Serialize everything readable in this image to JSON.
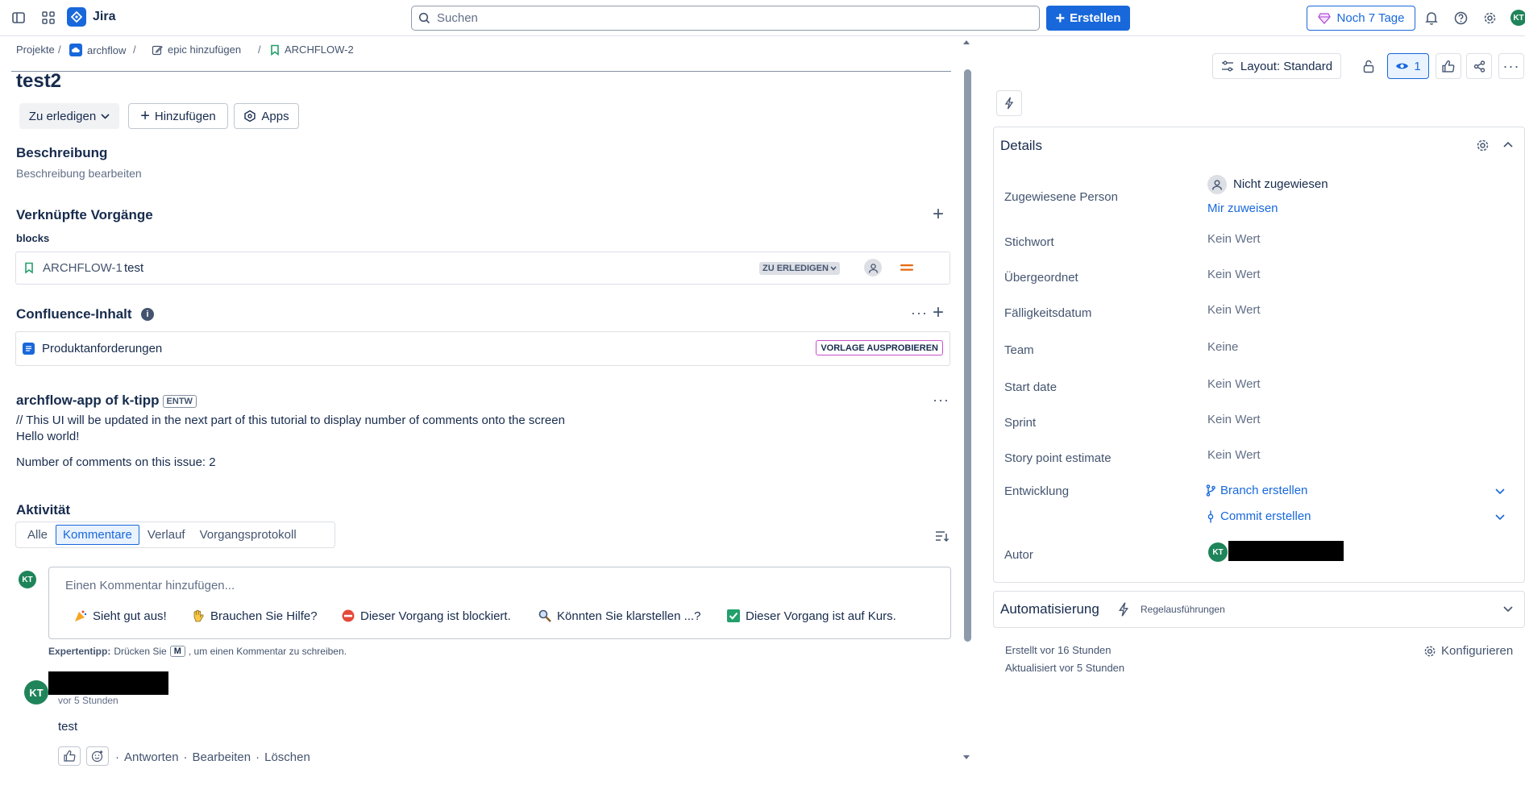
{
  "nav": {
    "app_name": "Jira",
    "search_placeholder": "Suchen",
    "create_label": "Erstellen",
    "trial_label": "Noch 7 Tage",
    "user_initials": "KT"
  },
  "breadcrumb": {
    "items": [
      "Projekte",
      "archflow",
      "epic hinzufügen",
      "ARCHFLOW-2"
    ],
    "separator": "/"
  },
  "issue": {
    "title": "test2",
    "status_button": "Zu erledigen",
    "add_button": "Hinzufügen",
    "apps_button": "Apps"
  },
  "description": {
    "heading": "Beschreibung",
    "placeholder": "Beschreibung bearbeiten"
  },
  "linked": {
    "heading": "Verknüpfte Vorgänge",
    "relation": "blocks",
    "items": [
      {
        "key": "ARCHFLOW-1",
        "summary": "test",
        "status": "ZU ERLEDIGEN"
      }
    ]
  },
  "confluence": {
    "heading": "Confluence-Inhalt",
    "items": [
      {
        "title": "Produktanforderungen",
        "action": "VORLAGE AUSPROBIEREN"
      }
    ]
  },
  "app_panel": {
    "title": "archflow-app of k-tipp",
    "tag": "ENTW",
    "line1": "// This UI will be updated in the next part of this tutorial to display number of comments onto the screen",
    "line2": "Hello world!",
    "line3": "Number of comments on this issue: 2"
  },
  "activity": {
    "heading": "Aktivität",
    "tabs": [
      "Alle",
      "Kommentare",
      "Verlauf",
      "Vorgangsprotokoll"
    ],
    "active_tab": "Kommentare",
    "comment_placeholder": "Einen Kommentar hinzufügen...",
    "quick_replies": [
      "Sieht gut aus!",
      "Brauchen Sie Hilfe?",
      "Dieser Vorgang ist blockiert.",
      "Könnten Sie klarstellen ...?",
      "Dieser Vorgang ist auf Kurs."
    ],
    "tip_bold": "Expertentipp:",
    "tip_pre": "Drücken Sie",
    "tip_key": "M",
    "tip_post": ", um einen Kommentar zu schreiben."
  },
  "comments": [
    {
      "initials": "KT",
      "time": "vor 5 Stunden",
      "body": "test",
      "actions": [
        "Antworten",
        "Bearbeiten",
        "Löschen"
      ],
      "action_sep": "·"
    }
  ],
  "right_toolbar": {
    "layout_label": "Layout: Standard",
    "watch_count": "1"
  },
  "details": {
    "heading": "Details",
    "fields": [
      {
        "label": "Zugewiesene Person",
        "value": "Nicht zugewiesen",
        "action": "Mir zuweisen"
      },
      {
        "label": "Stichwort",
        "value": "Kein Wert"
      },
      {
        "label": "Übergeordnet",
        "value": "Kein Wert"
      },
      {
        "label": "Fälligkeitsdatum",
        "value": "Kein Wert"
      },
      {
        "label": "Team",
        "value": "Keine"
      },
      {
        "label": "Start date",
        "value": "Kein Wert"
      },
      {
        "label": "Sprint",
        "value": "Kein Wert"
      },
      {
        "label": "Story point estimate",
        "value": "Kein Wert"
      },
      {
        "label": "Entwicklung",
        "value": "Branch erstellen",
        "value2": "Commit erstellen"
      },
      {
        "label": "Autor",
        "initials": "KT"
      }
    ]
  },
  "automation": {
    "heading": "Automatisierung",
    "sub": "Regelausführungen"
  },
  "footer_meta": {
    "created": "Erstellt vor 16 Stunden",
    "updated": "Aktualisiert vor 5 Stunden",
    "configure": "Konfigurieren"
  },
  "colors": {
    "brand_blue": "#1868db",
    "avatar_green": "#1f845a",
    "priority_orange": "#e56910"
  }
}
